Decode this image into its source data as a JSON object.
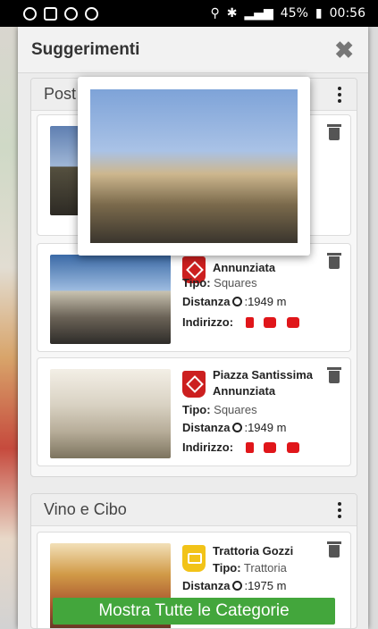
{
  "statusbar": {
    "battery": "45%",
    "time": "00:56"
  },
  "dialog": {
    "title": "Suggerimenti",
    "close": "✖"
  },
  "sections": [
    {
      "title": "Post",
      "cards": [
        {},
        {
          "name": "Piazza Ss. Annunziata",
          "tipo_label": "Tipo:",
          "tipo": "Squares",
          "distanza_label": "Distanza",
          "distanza": ":1949 m",
          "indirizzo_label": "Indirizzo:"
        },
        {
          "name": "Piazza Santissima Annunziata",
          "tipo_label": "Tipo:",
          "tipo": "Squares",
          "distanza_label": "Distanza",
          "distanza": ":1949 m",
          "indirizzo_label": "Indirizzo:"
        }
      ]
    },
    {
      "title": "Vino e Cibo",
      "cards": [
        {
          "name": "Trattoria Gozzi",
          "tipo_label": "Tipo:",
          "tipo": "Trattoria",
          "distanza_label": "Distanza",
          "distanza": ":1975 m"
        }
      ]
    }
  ],
  "footer": {
    "button": "Mostra Tutte le Categorie"
  },
  "colors": {
    "accent": "#43a63c",
    "pin_red": "#cc1f1f",
    "pin_yellow": "#f2c318",
    "transport": "#e0161a"
  }
}
